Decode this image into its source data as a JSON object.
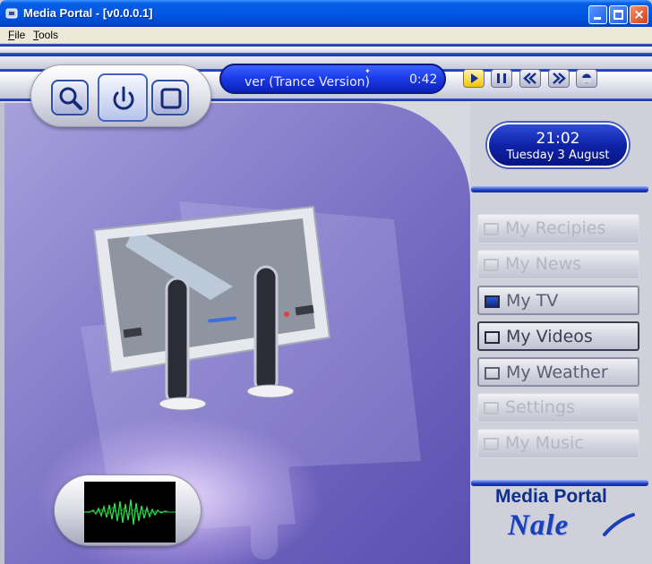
{
  "window": {
    "title": "Media Portal - [v0.0.0.1]",
    "controls": {
      "close_glyph": "×"
    }
  },
  "menubar": {
    "items": [
      {
        "accel": "F",
        "rest": "ile"
      },
      {
        "accel": "T",
        "rest": "ools"
      }
    ]
  },
  "player": {
    "now_playing": "ver (Trance Version)",
    "time": "0:42",
    "transport_icons": [
      "play-icon",
      "pause-icon",
      "rewind-icon",
      "fast-forward-icon",
      "record-icon"
    ]
  },
  "top_controls": {
    "icons": [
      "search-icon",
      "power-icon",
      "stop-icon"
    ]
  },
  "clock": {
    "time": "21:02",
    "date": "Tuesday 3 August"
  },
  "menu": {
    "items": [
      {
        "label": "My Recipies",
        "state": "disabled"
      },
      {
        "label": "My News",
        "state": "disabled"
      },
      {
        "label": "My TV",
        "state": "selected"
      },
      {
        "label": "My Videos",
        "state": "focused"
      },
      {
        "label": "My Weather",
        "state": "enabled"
      },
      {
        "label": "Settings",
        "state": "disabled"
      },
      {
        "label": "My Music",
        "state": "disabled"
      }
    ]
  },
  "brand": {
    "name": "Media Portal",
    "logo": "Nale"
  },
  "colors": {
    "accent": "#1d3dea",
    "stage": "#6f62bd",
    "titlebar": "#0058e6"
  }
}
